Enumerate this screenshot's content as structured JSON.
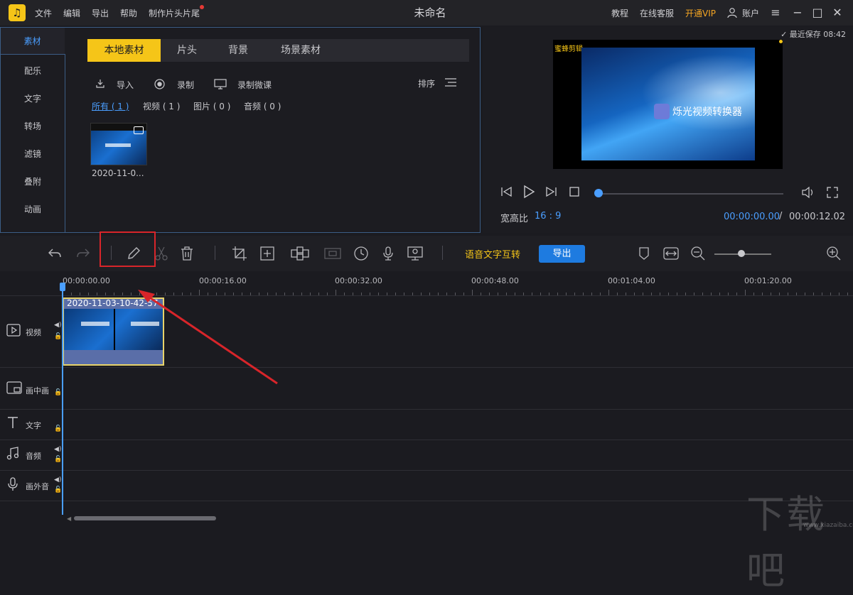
{
  "titlebar": {
    "logo": "♫",
    "menu": [
      "文件",
      "编辑",
      "导出",
      "帮助",
      "制作片头片尾"
    ],
    "title": "未命名",
    "right": {
      "tutorial": "教程",
      "support": "在线客服",
      "vip": "开通VIP",
      "account": "账户"
    }
  },
  "side_nav": [
    "素材",
    "配乐",
    "文字",
    "转场",
    "滤镜",
    "叠附",
    "动画"
  ],
  "library": {
    "tabs": [
      "本地素材",
      "片头",
      "背景",
      "场景素材"
    ],
    "actions": {
      "import": "导入",
      "record": "录制",
      "record_lesson": "录制微课",
      "sort": "排序"
    },
    "filters": [
      "所有 ( 1 )",
      "视频 ( 1 )",
      "图片 ( 0 )",
      "音频 ( 0 )"
    ],
    "item_label": "2020-11-0..."
  },
  "preview": {
    "saved": "最近保存 08:42",
    "watermark": "蜜蜂剪辑",
    "screen_text": "烁光视频转换器",
    "ratio_label": "宽高比",
    "ratio_value": "16 : 9",
    "time_current": "00:00:00.00",
    "time_sep": "/",
    "time_total": "00:00:12.02"
  },
  "toolbar": {
    "speech_text": "语音文字互转",
    "export": "导出"
  },
  "timeline": {
    "ruler": [
      "00:00:00.00",
      "00:00:16.00",
      "00:00:32.00",
      "00:00:48.00",
      "00:01:04.00",
      "00:01:20.00"
    ],
    "tracks": [
      "视频",
      "画中画",
      "文字",
      "音频",
      "画外音"
    ],
    "clip_title": "2020-11-03-10-42-57"
  },
  "watermark": {
    "main": "下载吧",
    "sub": "www.xiazaiba.com"
  },
  "colors": {
    "accent": "#4a9eff",
    "tab_active": "#f5c518",
    "highlight": "#d8252a",
    "export_btn": "#1e7be0"
  }
}
